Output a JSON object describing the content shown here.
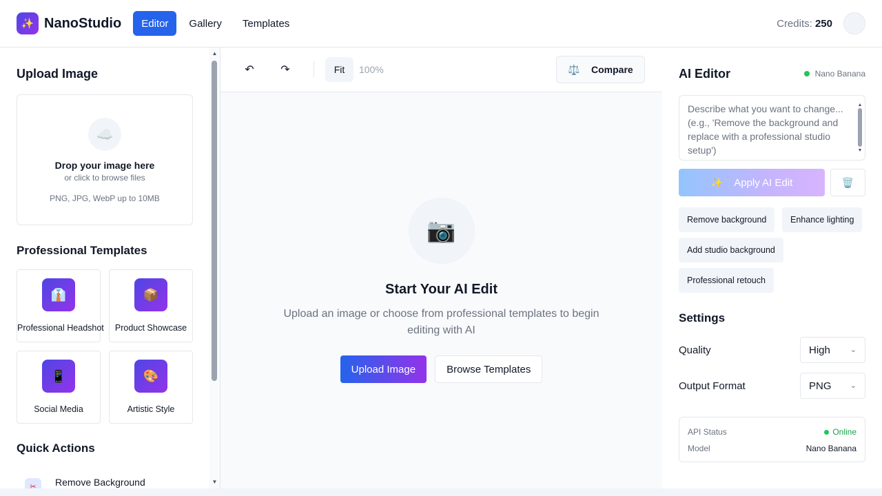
{
  "header": {
    "logo_icon": "sparkles-icon",
    "logo_glyph": "✨",
    "app_name": "NanoStudio",
    "tabs": [
      {
        "label": "Editor",
        "active": true
      },
      {
        "label": "Gallery",
        "active": false
      },
      {
        "label": "Templates",
        "active": false
      }
    ],
    "credits_label": "Credits:",
    "credits_value": "250"
  },
  "left": {
    "upload_title": "Upload Image",
    "dropzone": {
      "icon": "cloud-upload-icon",
      "glyph": "☁️",
      "main": "Drop your image here",
      "sub": "or click to browse files",
      "formats": "PNG, JPG, WebP up to 10MB"
    },
    "templates_title": "Professional Templates",
    "templates": [
      {
        "label": "Professional Headshot",
        "icon": "necktie-icon",
        "glyph": "👔"
      },
      {
        "label": "Product Showcase",
        "icon": "package-icon",
        "glyph": "📦"
      },
      {
        "label": "Social Media",
        "icon": "phone-icon",
        "glyph": "📱"
      },
      {
        "label": "Artistic Style",
        "icon": "palette-icon",
        "glyph": "🎨"
      }
    ],
    "quick_actions_title": "Quick Actions",
    "quick_actions": [
      {
        "label": "Remove Background",
        "icon": "scissors-icon",
        "glyph": "✂"
      }
    ]
  },
  "toolbar": {
    "undo_glyph": "↶",
    "redo_glyph": "↷",
    "fit_label": "Fit",
    "zoom": "100%",
    "compare_label": "Compare",
    "compare_glyph": "⚖️"
  },
  "canvas": {
    "camera_glyph": "📷",
    "title": "Start Your AI Edit",
    "description": "Upload an image or choose from professional templates to begin editing with AI",
    "upload_button": "Upload Image",
    "browse_button": "Browse Templates"
  },
  "right": {
    "title": "AI Editor",
    "model_badge": "Nano Banana",
    "prompt_placeholder": "Describe what you want to change... (e.g., 'Remove the background and replace with a professional studio setup')",
    "apply_label": "Apply AI Edit",
    "apply_glyph": "✨",
    "trash_glyph": "🗑️",
    "chips": [
      "Remove background",
      "Enhance lighting",
      "Add studio background",
      "Professional retouch"
    ],
    "settings_title": "Settings",
    "quality_label": "Quality",
    "quality_value": "High",
    "format_label": "Output Format",
    "format_value": "PNG",
    "status": {
      "api_label": "API Status",
      "api_value": "Online",
      "model_label": "Model",
      "model_value": "Nano Banana"
    }
  },
  "colors": {
    "accent": "#2563eb",
    "brand_gradient_end": "#9333ea",
    "online": "#22c55e"
  }
}
